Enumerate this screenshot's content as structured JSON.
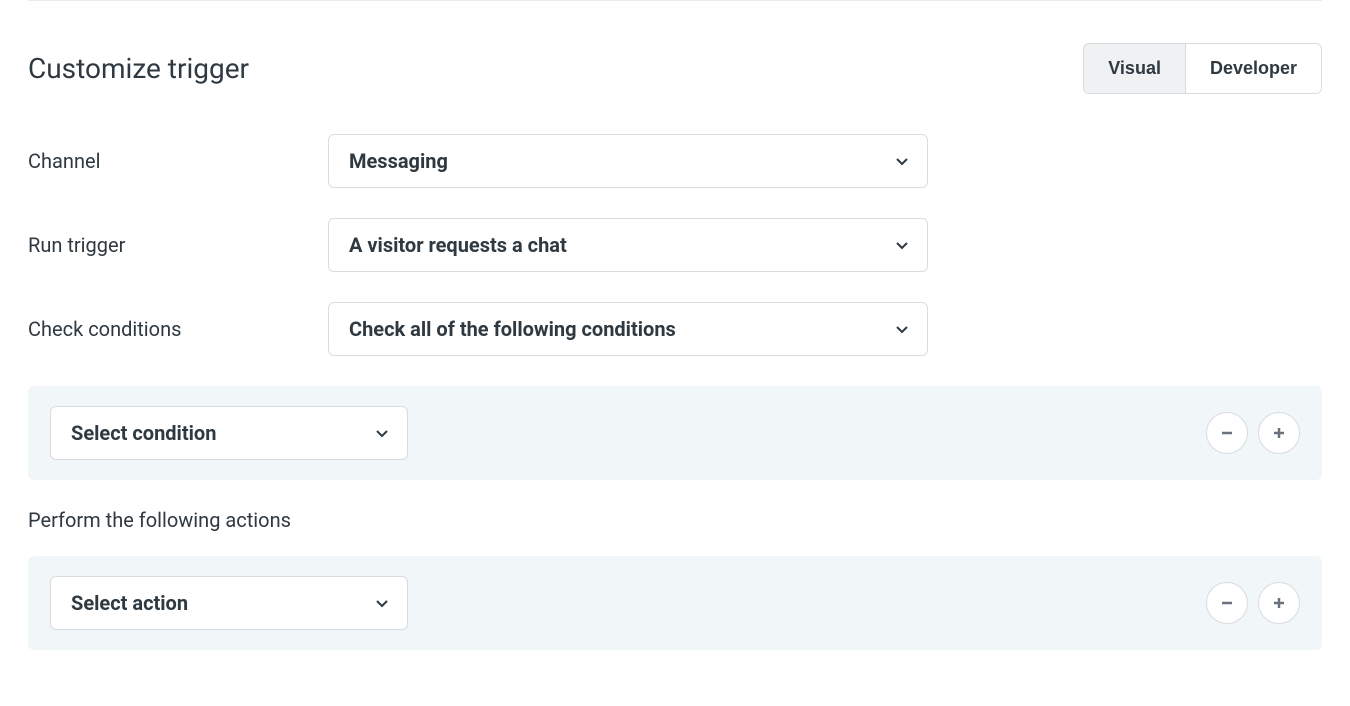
{
  "header": {
    "title": "Customize trigger",
    "tabs": {
      "visual": "Visual",
      "developer": "Developer",
      "active": "visual"
    }
  },
  "fields": {
    "channel": {
      "label": "Channel",
      "value": "Messaging"
    },
    "run_trigger": {
      "label": "Run trigger",
      "value": "A visitor requests a chat"
    },
    "check_conditions": {
      "label": "Check conditions",
      "value": "Check all of the following conditions"
    }
  },
  "conditions": {
    "placeholder": "Select condition"
  },
  "actions": {
    "section_label": "Perform the following actions",
    "placeholder": "Select action"
  }
}
